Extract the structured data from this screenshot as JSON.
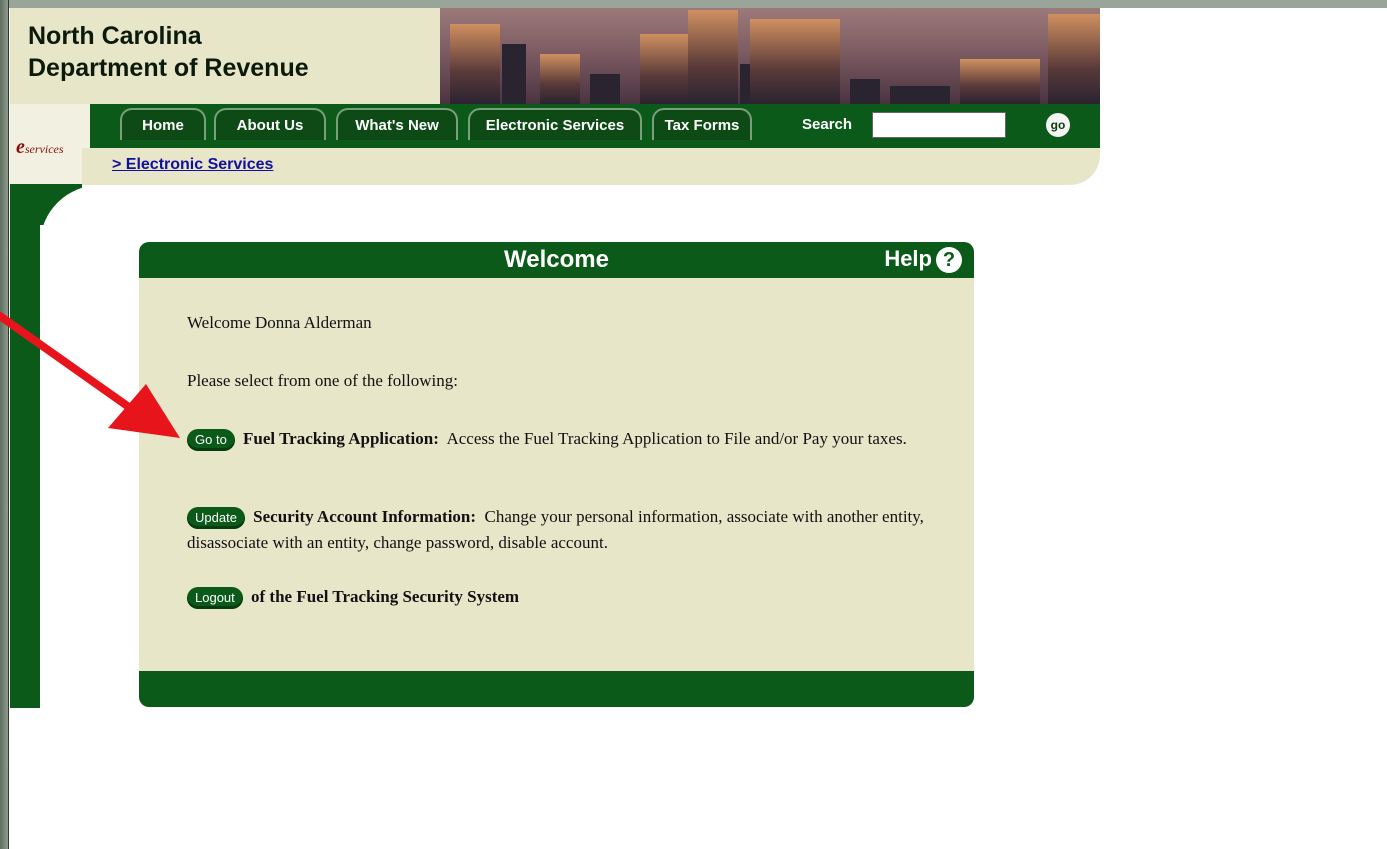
{
  "header": {
    "org_line1": "North Carolina",
    "org_line2": "Department of Revenue"
  },
  "eservices_logo": {
    "letter": "e",
    "text": "services"
  },
  "nav": {
    "tabs": [
      "Home",
      "About Us",
      "What's New",
      "Electronic Services",
      "Tax Forms"
    ],
    "search_label": "Search",
    "search_value": "",
    "go_label": "go"
  },
  "breadcrumb": "> Electronic Services",
  "panel": {
    "title": "Welcome",
    "help_label": "Help",
    "help_icon": "?",
    "greeting": "Welcome Donna Alderman",
    "instruction": "Please select from one of the following:",
    "options": [
      {
        "button": "Go to",
        "title": "Fuel Tracking Application:",
        "desc": "Access the Fuel Tracking Application to File and/or Pay your taxes."
      },
      {
        "button": "Update",
        "title": "Security Account Information:",
        "desc": "Change your personal information, associate with another entity, disassociate with an entity, change password, disable account."
      },
      {
        "button": "Logout",
        "title": "of the Fuel Tracking Security System",
        "desc": ""
      }
    ]
  },
  "colors": {
    "nav_green": "#0b5a1a",
    "panel_beige": "#e8e6c9",
    "arrow_red": "#e8141c",
    "link_blue": "#1010a0"
  }
}
